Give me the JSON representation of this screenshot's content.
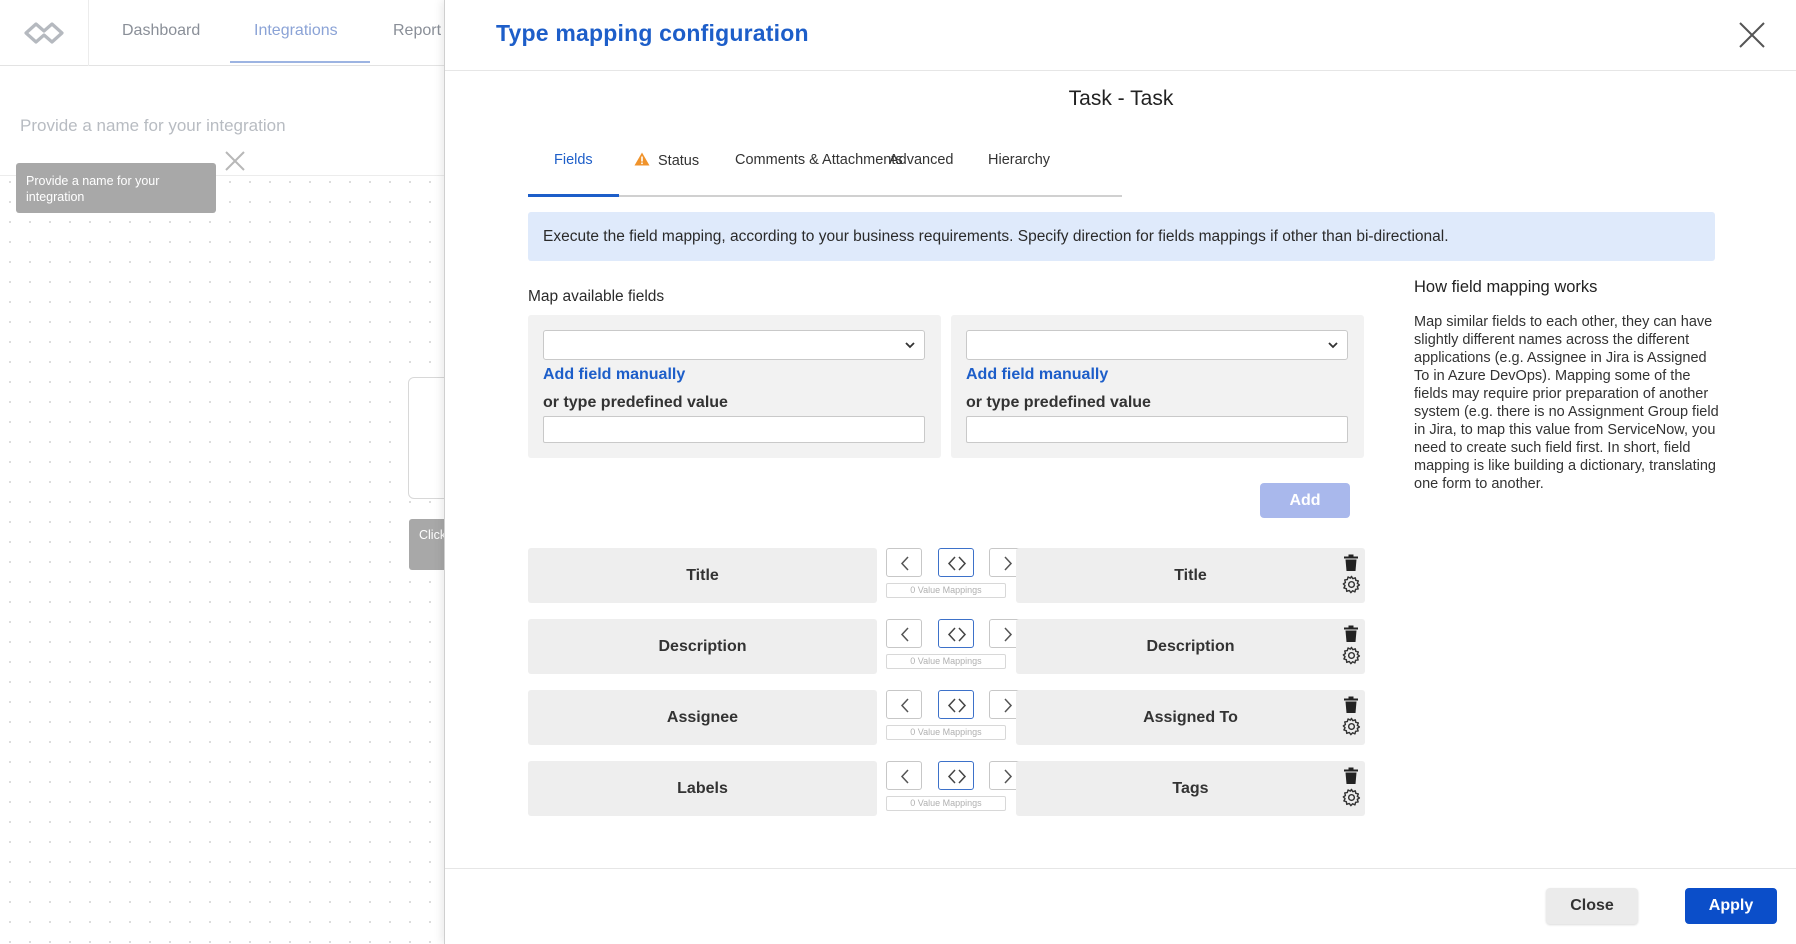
{
  "background_app": {
    "nav": {
      "dashboard": "Dashboard",
      "integrations": "Integrations",
      "reports": "Report"
    },
    "name_placeholder": "Provide a name for your integration",
    "tooltip": "Provide a name for your integration",
    "card_tooltip": "Click edit"
  },
  "modal": {
    "title": "Type mapping configuration",
    "type_title": "Task - Task",
    "tabs": [
      {
        "label": "Fields",
        "active": true
      },
      {
        "label": "Status",
        "icon": "warning-icon"
      },
      {
        "label": "Comments & Attachments"
      },
      {
        "label": "Advanced"
      },
      {
        "label": "Hierarchy"
      }
    ],
    "info_banner": "Execute the field mapping, according to your business requirements. Specify direction for fields mappings if other than bi-directional.",
    "map_label": "Map available fields",
    "left_field": {
      "select_value": "",
      "add_manual": "Add field manually",
      "predef_label": "or type predefined value",
      "predef_value": ""
    },
    "right_field": {
      "select_value": "",
      "add_manual": "Add field manually",
      "predef_label": "or type predefined value",
      "predef_value": ""
    },
    "add_label": "Add",
    "mappings": [
      {
        "left": "Title",
        "right": "Title",
        "value_mappings": "0 Value Mappings",
        "direction": "both"
      },
      {
        "left": "Description",
        "right": "Description",
        "value_mappings": "0 Value Mappings",
        "direction": "both"
      },
      {
        "left": "Assignee",
        "right": "Assigned To",
        "value_mappings": "0 Value Mappings",
        "direction": "both"
      },
      {
        "left": "Labels",
        "right": "Tags",
        "value_mappings": "0 Value Mappings",
        "direction": "both"
      }
    ],
    "help": {
      "title": "How field mapping works",
      "text": "Map similar fields to each other, they can have slightly different names across the different applications (e.g. Assignee in Jira is Assigned To in Azure DevOps). Mapping some of the fields may require prior preparation of another system (e.g. there is no Assignment Group field in Jira, to map this value from ServiceNow, you need to create such field first. In short, field mapping is like building a dictionary, translating one form to another."
    },
    "footer": {
      "close_label": "Close",
      "apply_label": "Apply"
    }
  },
  "colors": {
    "accent": "#1d5ec9",
    "apply": "#0b4ec9",
    "banner": "#dfeafb",
    "warning": "#f0932b"
  }
}
